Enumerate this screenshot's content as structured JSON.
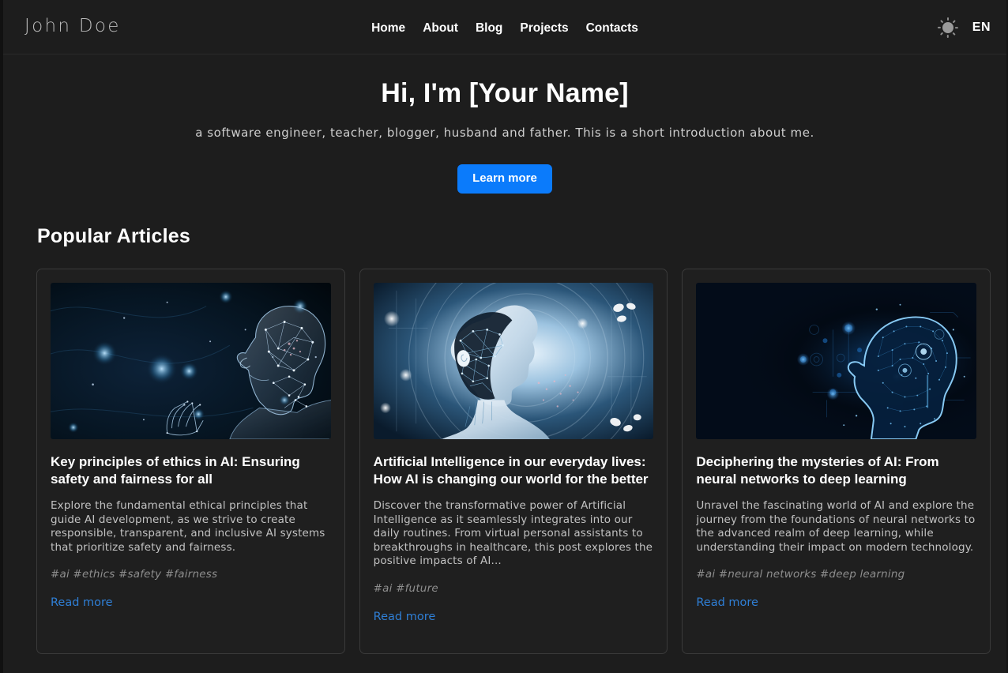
{
  "header": {
    "brand": "John Doe",
    "nav": [
      {
        "label": "Home"
      },
      {
        "label": "About"
      },
      {
        "label": "Blog"
      },
      {
        "label": "Projects"
      },
      {
        "label": "Contacts"
      }
    ],
    "theme_toggle_icon": "sun-icon",
    "language": "EN"
  },
  "hero": {
    "title": "Hi, I'm [Your Name]",
    "subtitle": "a software engineer, teacher, blogger, husband and father. This is a short introduction about me.",
    "cta_label": "Learn more"
  },
  "articles": {
    "section_title": "Popular Articles",
    "read_more_label": "Read more",
    "items": [
      {
        "image_alt": "wireframe-human-head-profile-network-nodes",
        "title": "Key principles of ethics in AI: Ensuring safety and fairness for all",
        "excerpt": "Explore the fundamental ethical principles that guide AI development, as we strive to create responsible, transparent, and inclusive AI systems that prioritize safety and fairness.",
        "tags": "#ai #ethics #safety #fairness",
        "link_label": "Read more"
      },
      {
        "image_alt": "android-head-profile-glowing-rings",
        "title": "Artificial Intelligence in our everyday lives: How AI is changing our world for the better",
        "excerpt": "Discover the transformative power of Artificial Intelligence as it seamlessly integrates into our daily routines. From virtual personal assistants to breakthroughs in healthcare, this post explores the positive impacts of AI...",
        "tags": "#ai #future",
        "link_label": "Read more"
      },
      {
        "image_alt": "blue-outlined-head-digital-interface",
        "title": "Deciphering the mysteries of AI: From neural networks to deep learning",
        "excerpt": "Unravel the fascinating world of AI and explore the journey from the foundations of neural networks to the advanced realm of deep learning, while understanding their impact on modern technology.",
        "tags": "#ai #neural networks #deep learning",
        "link_label": "Read more"
      }
    ]
  },
  "colors": {
    "page_background": "#1d1d1d",
    "card_background": "#1f1f1f",
    "card_border": "#3a3a3a",
    "accent_blue": "#0b7bfb",
    "link_blue": "#2f7fd6",
    "text_primary": "#ffffff",
    "text_secondary": "#c2c2c2",
    "text_muted": "#8e8e8e"
  }
}
